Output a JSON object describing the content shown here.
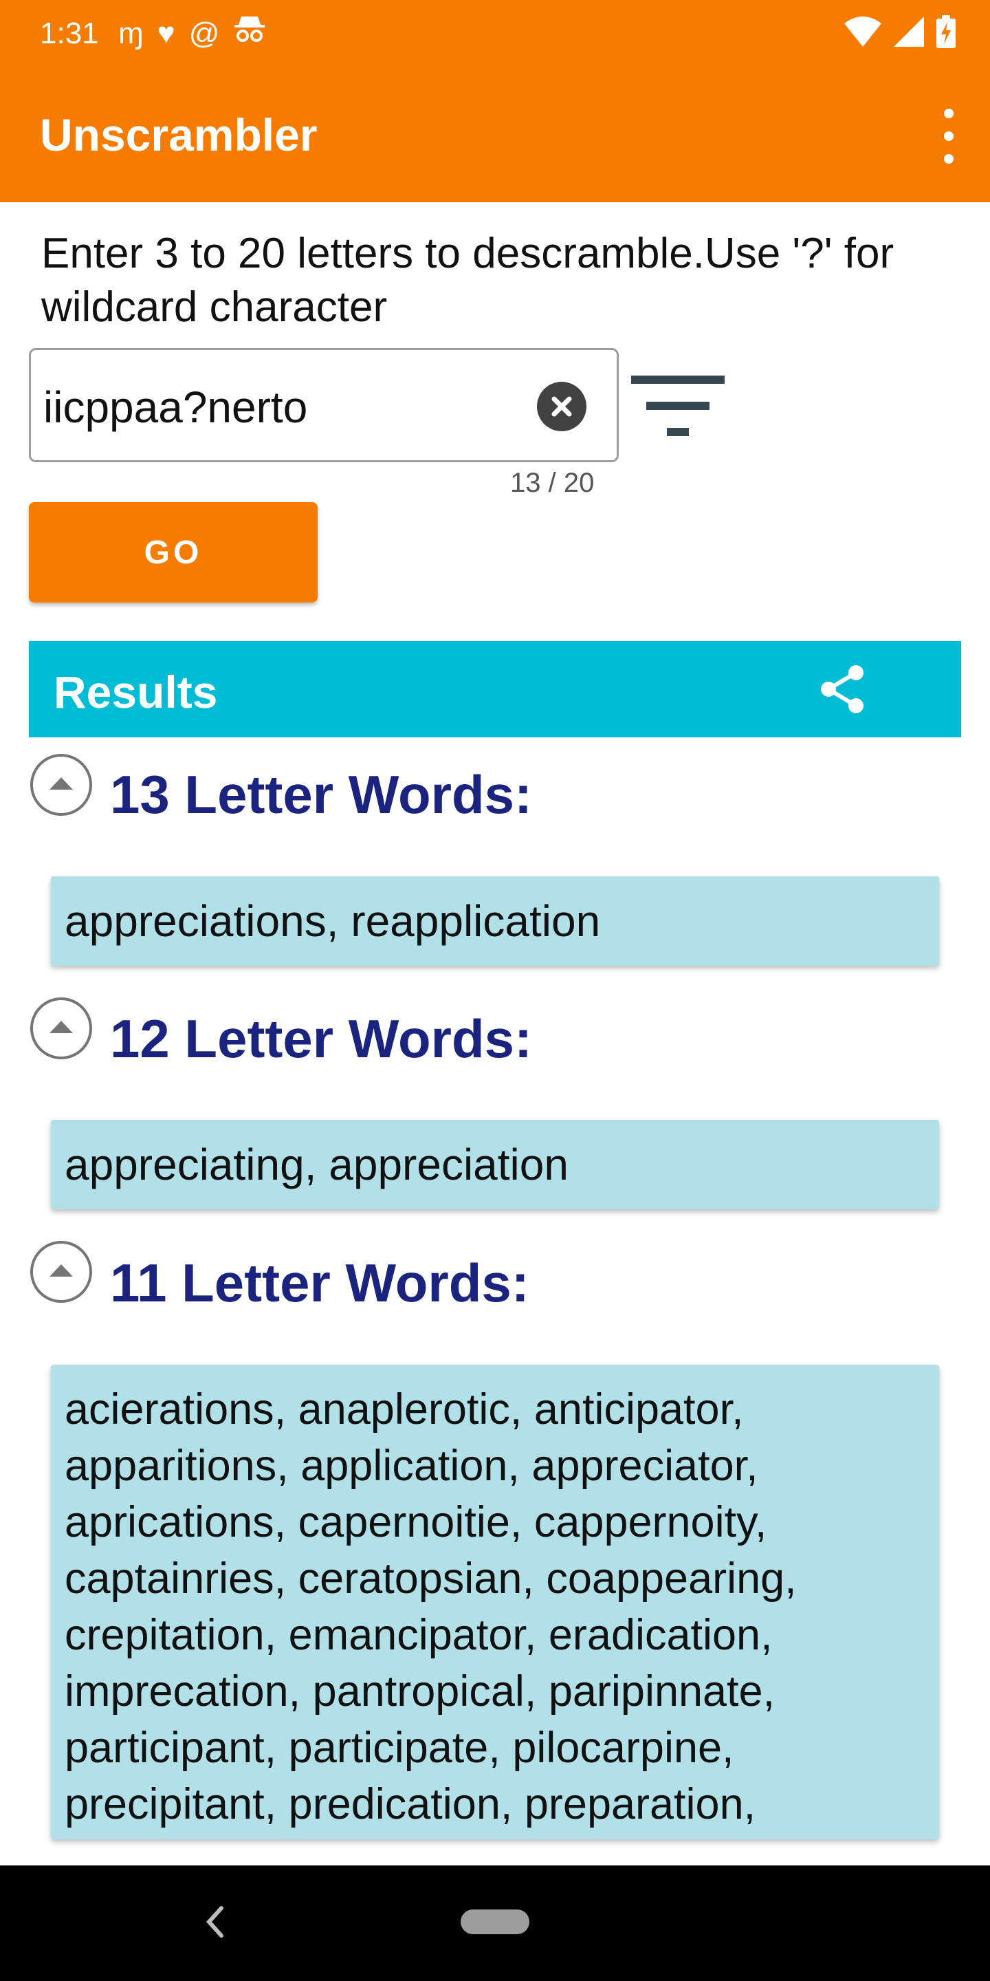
{
  "status_bar": {
    "time": "1:31",
    "left_icons": [
      "m-notification-icon",
      "heart-check-icon",
      "at-sign-icon",
      "incognito-icon"
    ],
    "right_icons": [
      "wifi-icon",
      "signal-icon",
      "battery-charging-icon"
    ]
  },
  "app_bar": {
    "title": "Unscrambler",
    "menu_icon": "overflow-menu-icon"
  },
  "instructions": "Enter 3 to 20 letters to descramble.Use '?' for wildcard character",
  "input": {
    "value": "iicppaa?nerto",
    "counter": "13 / 20"
  },
  "go_button": "GO",
  "results": {
    "title": "Results",
    "sections": [
      {
        "title": "13 Letter Words:",
        "words": "appreciations, reapplication"
      },
      {
        "title": "12 Letter Words:",
        "words": "appreciating, appreciation"
      },
      {
        "title": "11 Letter Words:",
        "words": "acierations, anaplerotic, anticipator, apparitions, application, appreciator, aprications, capernoitie, cappernoity, captainries, ceratopsian, coappearing, crepitation, emancipator, eradication, imprecation, pantropical, paripinnate, participant, participate, pilocarpine, precipitant, predication, preparation,"
      }
    ]
  },
  "colors": {
    "primary": "#F57C00",
    "results_bar": "#00BCD4",
    "word_box": "#B2E0E8",
    "section_title": "#1A237E"
  }
}
